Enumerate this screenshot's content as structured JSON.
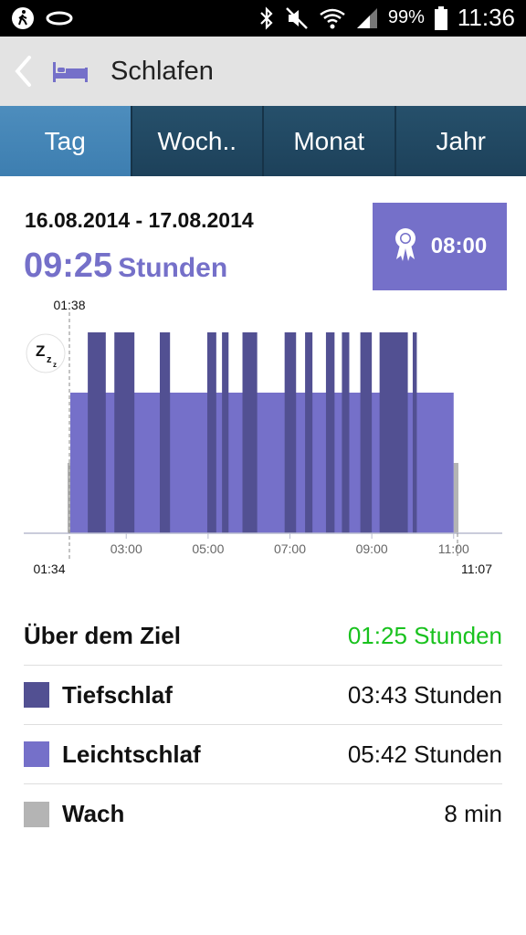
{
  "status_bar": {
    "battery": "99%",
    "time": "11:36",
    "icons": [
      "walking-icon",
      "band-icon",
      "bluetooth-icon",
      "mute-icon",
      "wifi-icon",
      "signal-icon",
      "battery-icon"
    ]
  },
  "app_bar": {
    "title": "Schlafen",
    "back_icon": "chevron-left-icon",
    "title_icon": "bed-icon"
  },
  "tabs": [
    {
      "label": "Tag",
      "active": true
    },
    {
      "label": "Woch..",
      "active": false
    },
    {
      "label": "Monat",
      "active": false
    },
    {
      "label": "Jahr",
      "active": false
    }
  ],
  "summary": {
    "date_range": "16.08.2014 - 17.08.2014",
    "duration_value": "09:25",
    "duration_unit": "Stunden",
    "goal": "08:00",
    "goal_icon": "ribbon-icon"
  },
  "chart_data": {
    "type": "area",
    "title": "",
    "start_label": "01:34",
    "sleep_onset_label": "01:38",
    "end_label": "11:07",
    "ticks": [
      "03:00",
      "05:00",
      "07:00",
      "09:00",
      "11:00"
    ],
    "tick_values": [
      3.0,
      5.0,
      7.0,
      9.0,
      11.0
    ],
    "xlim": [
      1.5667,
      11.1167
    ],
    "stages": {
      "wach": {
        "name": "Wach",
        "color": "#b4b4b4",
        "level": 0.35
      },
      "leicht": {
        "name": "Leichtschlaf",
        "color": "#7570c9",
        "level": 0.7
      },
      "tief": {
        "name": "Tiefschlaf",
        "color": "#525092",
        "level": 1.0
      }
    },
    "wake_segments": [
      [
        1.5667,
        1.6333
      ],
      [
        11.0,
        11.1167
      ]
    ],
    "light_segment": [
      1.6333,
      11.0
    ],
    "deep_segments": [
      [
        2.06,
        2.5
      ],
      [
        2.71,
        3.2
      ],
      [
        3.82,
        4.07
      ],
      [
        4.98,
        5.2
      ],
      [
        5.34,
        5.5
      ],
      [
        5.84,
        6.2
      ],
      [
        6.87,
        7.15
      ],
      [
        7.37,
        7.55
      ],
      [
        7.88,
        8.09
      ],
      [
        8.27,
        8.45
      ],
      [
        8.72,
        9.0
      ],
      [
        9.19,
        9.88
      ],
      [
        10.0,
        10.1
      ]
    ]
  },
  "stats": {
    "above_goal": {
      "label": "Über dem Ziel",
      "value": "01:25 Stunden",
      "color": "#19c21e"
    },
    "deep": {
      "label": "Tiefschlaf",
      "value": "03:43 Stunden",
      "color": "#525092"
    },
    "light": {
      "label": "Leichtschlaf",
      "value": "05:42 Stunden",
      "color": "#7570c9"
    },
    "awake": {
      "label": "Wach",
      "value": "8 min",
      "color": "#b4b4b4"
    }
  }
}
